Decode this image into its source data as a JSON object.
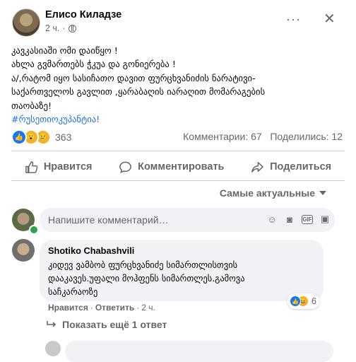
{
  "post": {
    "author": "Елисо Киладзе",
    "time": "2 ч.",
    "separator": "·",
    "more_label": "···",
    "close_label": "✕",
    "lines": [
      "კავკასიაში ომი დაიწყო !",
      "ახლა გვმართებს ჭკუა და  გონიერება !",
      "ა/,რატომ იყო სასიჩათო დავით ფურცხვანიძის ნარატივი-",
      "საქართველოს გავლით ,ყარაბაღის იარაღით მომარაგების",
      "თაობაზე!"
    ],
    "hashtag": "#რუსეთიოკუპანტია!",
    "reaction_count": "363",
    "comments_stat": "Комментарии: 67",
    "shares_stat": "Поделились: 12"
  },
  "actions": {
    "like": "Нравится",
    "comment": "Комментировать",
    "share": "Поделиться"
  },
  "sort": {
    "label": "Самые актуальные"
  },
  "composer": {
    "placeholder": "Напишите комментарий…"
  },
  "comment": {
    "author": "Shotiko Chabashvili",
    "lines": [
      "კიდევ ვამბობ ფურცხვანიძე სიმართლისთვის",
      "დააკავეს.უფალი მოჰფენს სიმართლეს.გამოვა",
      "საჩკარაოზე"
    ],
    "like_link": "Нравится",
    "reply_link": "Ответить",
    "time": "2 ч.",
    "dot": "·",
    "reaction_count": "6"
  },
  "replies": {
    "label": "Показать ещё 1 ответ"
  },
  "colors": {
    "accent": "#1877f2",
    "hashtag": "#216fdb",
    "muted": "#65676b",
    "bubble": "#f0f2f5"
  },
  "icons": [
    "globe-icon",
    "like-icon",
    "comment-icon",
    "share-icon",
    "emoji-icon",
    "camera-icon",
    "gif-icon",
    "sticker-icon",
    "reply-arrow-icon"
  ]
}
